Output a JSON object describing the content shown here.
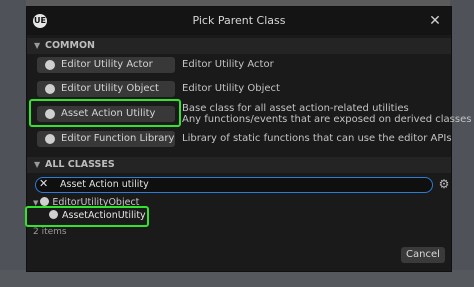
{
  "window": {
    "title": "Pick Parent Class",
    "logo": "UE",
    "close_glyph": "✕"
  },
  "common": {
    "header": "COMMON",
    "items": [
      {
        "label": "Editor Utility Actor",
        "desc": "Editor Utility Actor",
        "desc2": ""
      },
      {
        "label": "Editor Utility Object",
        "desc": "Editor Utility Object",
        "desc2": ""
      },
      {
        "label": "Asset Action Utility",
        "desc": "Base class for all asset action-related utilities",
        "desc2": "Any functions/events that are exposed on derived classes"
      },
      {
        "label": "Editor Function Library",
        "desc": "Library of static functions that can use the editor APIs",
        "desc2": ""
      }
    ]
  },
  "all_classes": {
    "header": "ALL CLASSES",
    "search_value": "Asset Action utility",
    "tree": {
      "parent": "EditorUtilityObject",
      "child": "AssetActionUtility"
    },
    "count": "2 items"
  },
  "footer": {
    "cancel_label": "Cancel"
  },
  "colors": {
    "highlight": "#33e22c",
    "search_border": "#2f7bd6"
  }
}
